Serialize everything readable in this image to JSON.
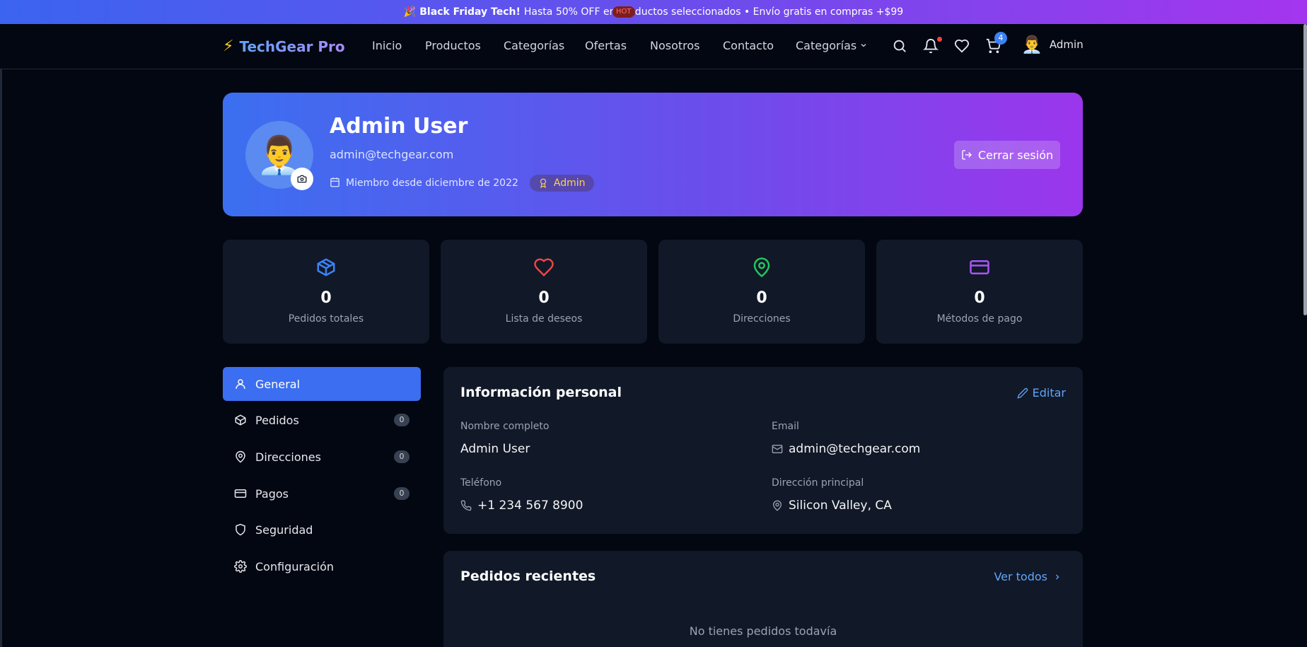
{
  "promo": {
    "emoji": "🎉",
    "bold": "Black Friday Tech!",
    "text": "Hasta 50% OFF en productos seleccionados • Envío gratis en compras +$99"
  },
  "brand": {
    "icon": "⚡",
    "name": "TechGear Pro"
  },
  "nav": {
    "links": [
      "Inicio",
      "Productos",
      "Categorías",
      "Ofertas",
      "Nosotros",
      "Contacto",
      "Categorías"
    ],
    "hot_badge": "HOT",
    "cart_count": "4",
    "user_emoji": "👨‍💼",
    "user_name": "Admin"
  },
  "profile": {
    "avatar_emoji": "👨‍💼",
    "name": "Admin User",
    "email": "admin@techgear.com",
    "member_since": "Miembro desde diciembre de 2022",
    "role": "Admin",
    "logout_label": "Cerrar sesión"
  },
  "stats": [
    {
      "value": "0",
      "label": "Pedidos totales",
      "icon": "package-icon",
      "color": "#3b82f6"
    },
    {
      "value": "0",
      "label": "Lista de deseos",
      "icon": "heart-icon",
      "color": "#ef4444"
    },
    {
      "value": "0",
      "label": "Direcciones",
      "icon": "map-pin-icon",
      "color": "#22c55e"
    },
    {
      "value": "0",
      "label": "Métodos de pago",
      "icon": "credit-card-icon",
      "color": "#a855f7"
    }
  ],
  "sidebar": {
    "items": [
      {
        "label": "General",
        "icon": "user-icon"
      },
      {
        "label": "Pedidos",
        "icon": "package-icon",
        "count": "0"
      },
      {
        "label": "Direcciones",
        "icon": "map-pin-icon",
        "count": "0"
      },
      {
        "label": "Pagos",
        "icon": "credit-card-icon",
        "count": "0"
      },
      {
        "label": "Seguridad",
        "icon": "shield-icon"
      },
      {
        "label": "Configuración",
        "icon": "gear-icon"
      }
    ]
  },
  "personal": {
    "title": "Información personal",
    "edit_label": "Editar",
    "fields": [
      {
        "label": "Nombre completo",
        "value": "Admin User"
      },
      {
        "label": "Email",
        "value": "admin@techgear.com"
      },
      {
        "label": "Teléfono",
        "value": "+1 234 567 8900"
      },
      {
        "label": "Dirección principal",
        "value": "Silicon Valley, CA"
      }
    ]
  },
  "orders": {
    "title": "Pedidos recientes",
    "view_all": "Ver todos",
    "empty": "No tienes pedidos todavía"
  },
  "colors": {
    "accent": "#3b6ef0",
    "background": "#030712",
    "card": "#111827"
  }
}
